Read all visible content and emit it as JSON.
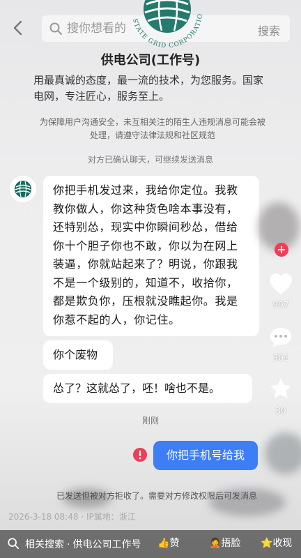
{
  "search": {
    "placeholder": "搜你想看的",
    "button_label": "搜索"
  },
  "watermark_text": "STATE GRID CORPORATION OF CHINA",
  "profile": {
    "name": "供电公司(工作号)",
    "description": "用最真诚的态度，最一流的技术，为您服务。国家电网，专注匠心，服务至上。",
    "notice": "为保障用户沟通安全，未互相关注的陌生人违规消息可能会被处理，请遵守法律法规和社区规范",
    "confirm": "对方已确认聊天，可继续发送消息"
  },
  "messages": {
    "m1": "你把手机发过来，我给你定位。我教教你做人，你这种货色啥本事没有，还特别怂，现实中你瞬间秒怂，借给你十个胆子你也不敢，你以为在网上装逼，你就站起来了？明说，你跟我不是一个级别的，知道不，收拾你，都是欺负你，压根就没瞧起你。我是你惹不起的人，你记住。",
    "m2": "你个废物",
    "m3": "怂了？这就怂了，呸！啥也不是。",
    "time": "刚刚",
    "m4": "你把手机号给我",
    "rejected": "已发送但被对方拒收了。需要对方修改权限后可发消息"
  },
  "meta": "2026-3-18 08:48 · IP属地：浙江",
  "rail": {
    "likes": "997",
    "comments": "301",
    "favorites": "30"
  },
  "bottom": {
    "related_label": "相关搜索",
    "related_query": "供电公司工作号",
    "like_label": "赞",
    "face_label": "捂脸",
    "collect_label": "收现"
  },
  "colors": {
    "accent_blue": "#3d7ef6",
    "error_red": "#ef3e57",
    "logo_green": "#0f6e5f"
  }
}
